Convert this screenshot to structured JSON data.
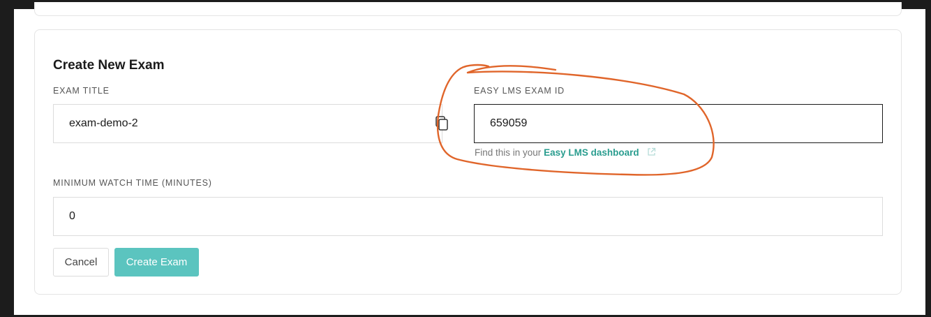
{
  "form": {
    "title": "Create New Exam",
    "exam_title": {
      "label": "EXAM TITLE",
      "value": "exam-demo-2"
    },
    "easy_lms_id": {
      "label": "EASY LMS EXAM ID",
      "value": "659059",
      "helper_prefix": "Find this in your",
      "helper_link": "Easy LMS dashboard"
    },
    "min_watch_time": {
      "label": "MINIMUM WATCH TIME (MINUTES)",
      "value": "0"
    }
  },
  "buttons": {
    "cancel": "Cancel",
    "create": "Create Exam"
  },
  "colors": {
    "accent": "#5bc4bf",
    "link": "#2a9d8f",
    "annotation": "#e0652a"
  },
  "icons": [
    "copy-icon",
    "external-link-icon"
  ]
}
